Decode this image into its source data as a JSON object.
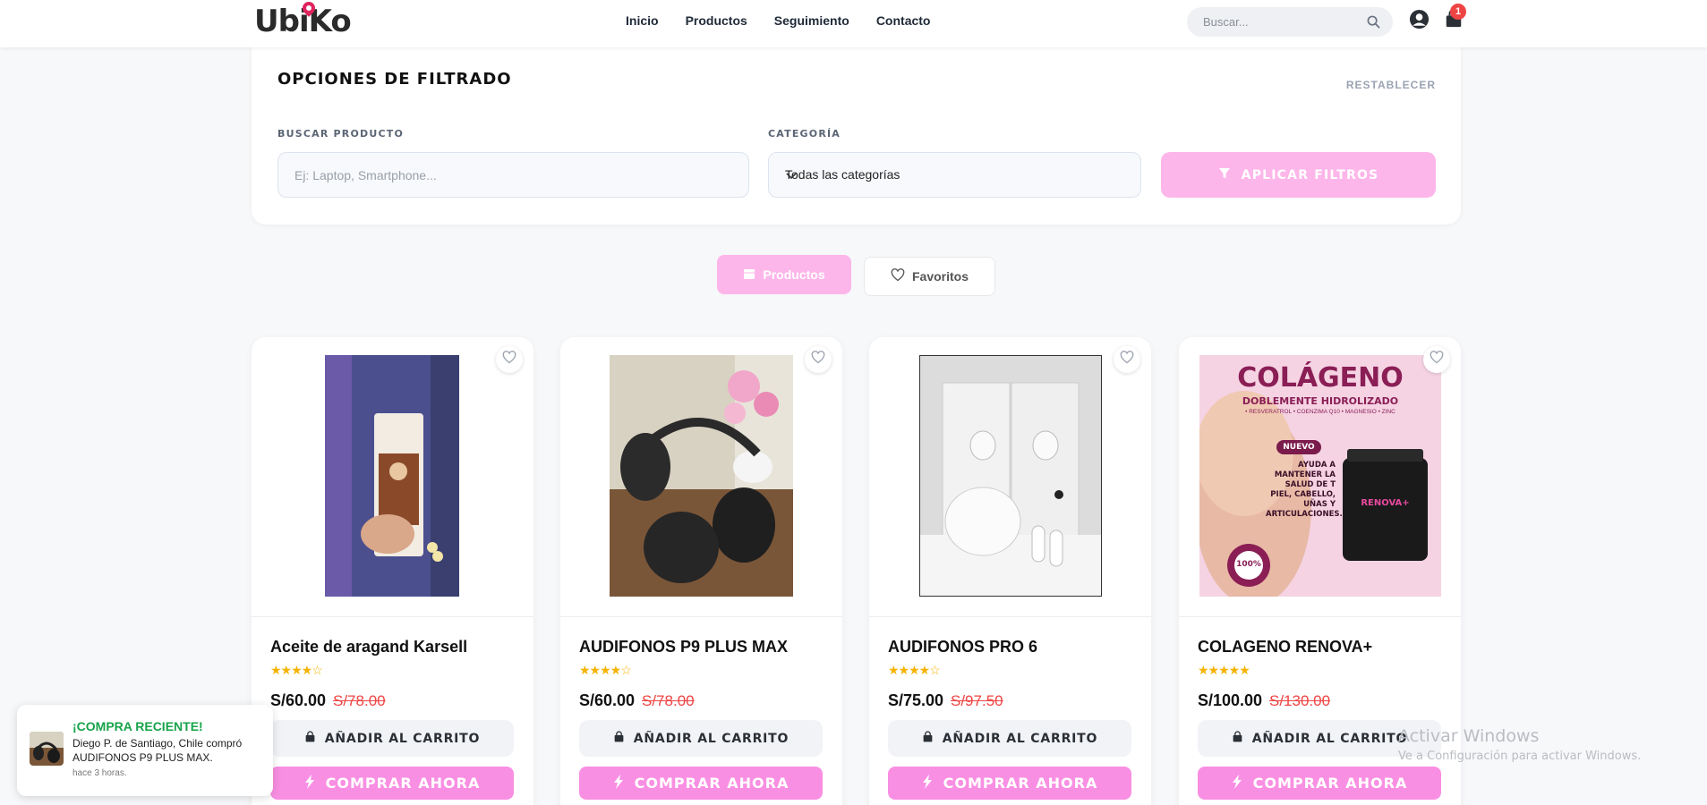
{
  "header": {
    "logo": "UbiKo",
    "nav": [
      "Inicio",
      "Productos",
      "Seguimiento",
      "Contacto"
    ],
    "search_placeholder": "Buscar...",
    "cart_count": "1"
  },
  "filters": {
    "title": "OPCIONES DE FILTRADO",
    "reset_label": "RESTABLECER",
    "search_label": "BUSCAR PRODUCTO",
    "search_placeholder": "Ej: Laptop, Smartphone...",
    "category_label": "CATEGORÍA",
    "category_value": "Todas las categorías",
    "apply_label": "APLICAR FILTROS"
  },
  "tabs": {
    "products": "Productos",
    "favorites": "Favoritos"
  },
  "products": [
    {
      "name": "Aceite de aragand Karsell",
      "price": "S/60.00",
      "old_price": "S/78.00",
      "rating": 4,
      "add_label": "AÑADIR AL CARRITO",
      "buy_label": "COMPRAR AHORA"
    },
    {
      "name": "AUDIFONOS P9 PLUS MAX",
      "price": "S/60.00",
      "old_price": "S/78.00",
      "rating": 4,
      "add_label": "AÑADIR AL CARRITO",
      "buy_label": "COMPRAR AHORA"
    },
    {
      "name": "AUDIFONOS PRO 6",
      "price": "S/75.00",
      "old_price": "S/97.50",
      "rating": 4,
      "add_label": "AÑADIR AL CARRITO",
      "buy_label": "COMPRAR AHORA"
    },
    {
      "name": "COLAGENO RENOVA+",
      "price": "S/100.00",
      "old_price": "S/130.00",
      "rating": 5,
      "add_label": "AÑADIR AL CARRITO",
      "buy_label": "COMPRAR AHORA"
    }
  ],
  "product_images": {
    "collagen": {
      "title": "COLÁGENO",
      "subtitle": "DOBLEMENTE HIDROLIZADO",
      "ingredients": "• RESVERATROL • COENZIMA Q10 • MAGNESIO • ZINC",
      "badge": "NUEVO",
      "benefit": "AYUDA A MANTENER LA SALUD DE T PIEL, CABELLO, UÑAS Y ARTICULACIONES.",
      "seal": "100%",
      "jar_label": "RENOVA+"
    }
  },
  "toast": {
    "title": "¡COMPRA RECIENTE!",
    "message": "Diego P. de Santiago, Chile compró AUDIFONOS P9 PLUS MAX.",
    "time": "hace 3 horas."
  },
  "watermark": {
    "line1": "Activar Windows",
    "line2": "Ve a Configuración para activar Windows."
  },
  "colors": {
    "accent_pink": "#fdb6ea",
    "buy_pink": "#f98fe2",
    "old_price_red": "#ef4444",
    "star_yellow": "#f5b301",
    "toast_green": "#16a34a"
  }
}
